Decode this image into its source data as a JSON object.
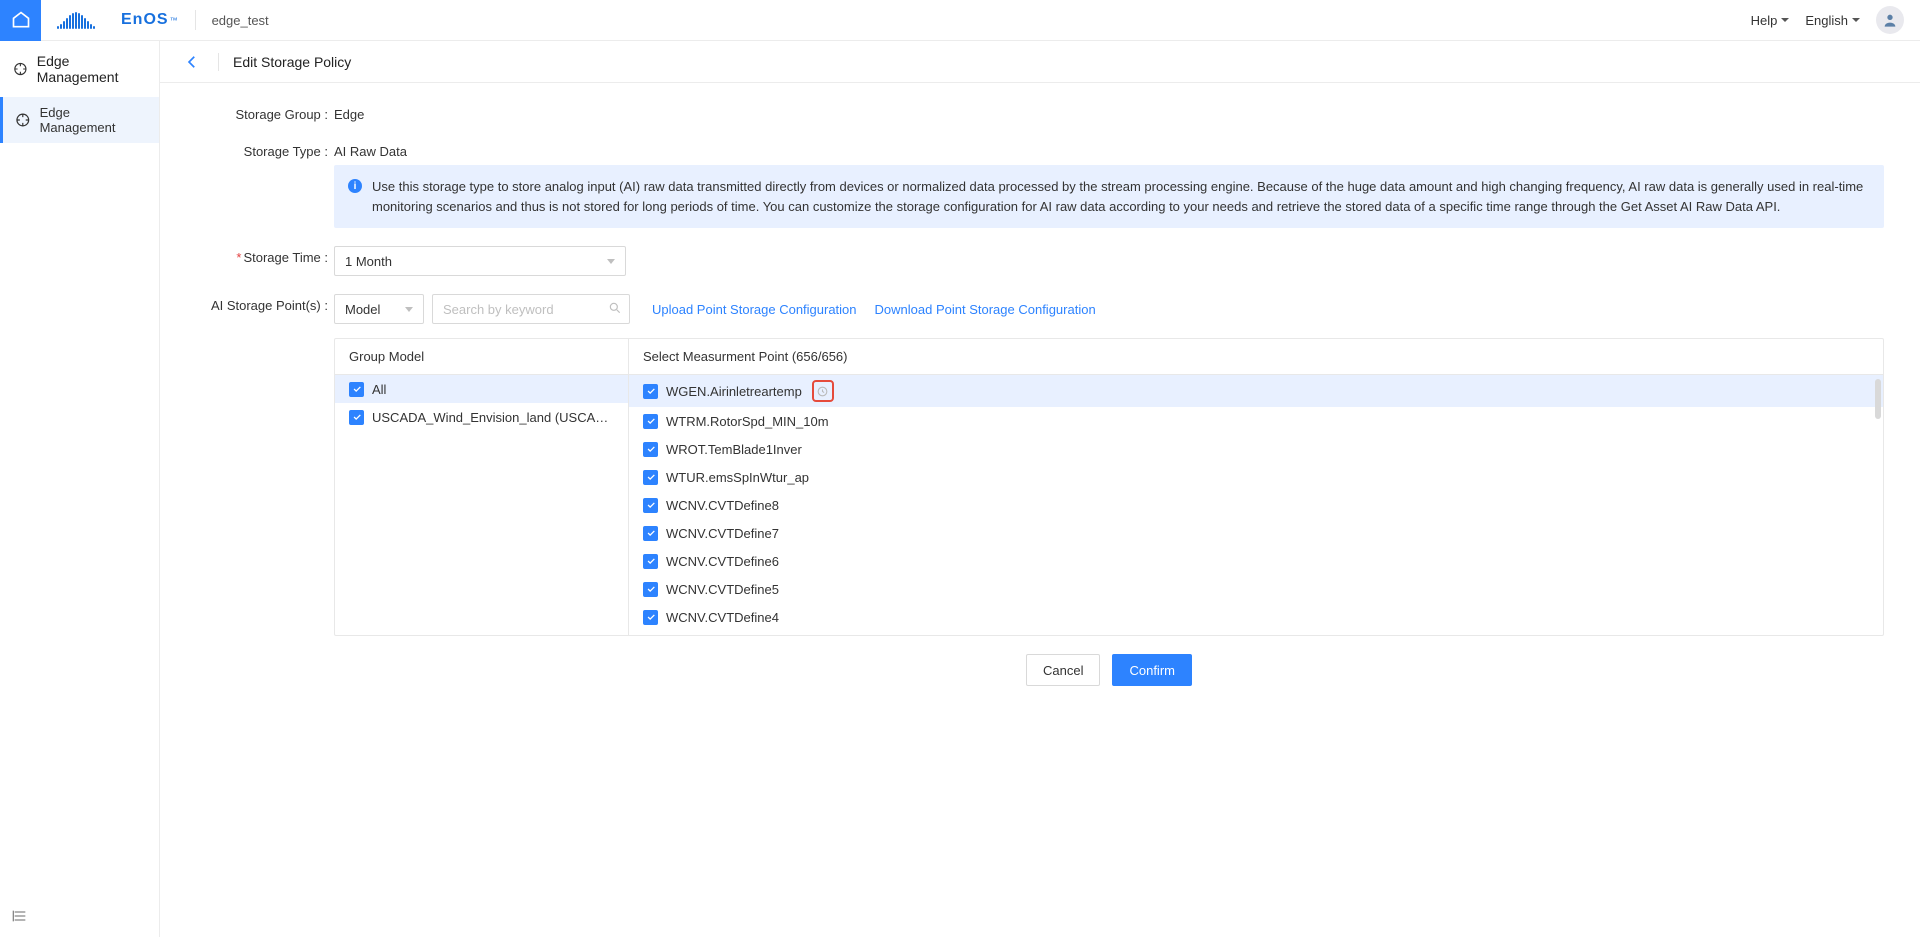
{
  "brand": {
    "name": "EnOS",
    "tm": "™"
  },
  "project": "edge_test",
  "top": {
    "help": "Help",
    "lang": "English"
  },
  "sidebar": {
    "header": "Edge Management",
    "item": "Edge Management"
  },
  "page": {
    "title": "Edit Storage Policy",
    "labels": {
      "storageGroup": "Storage Group :",
      "storageType": "Storage Type :",
      "storageTime": "Storage Time :",
      "storagePoints": "AI Storage Point(s) :"
    },
    "values": {
      "storageGroup": "Edge",
      "storageType": "AI Raw Data",
      "storageTime": "1 Month",
      "modelSel": "Model",
      "searchPlaceholder": "Search by keyword"
    },
    "info": "Use this storage type to store analog input (AI) raw data transmitted directly from devices or normalized data processed by the stream processing engine. Because of the huge data amount and high changing frequency, AI raw data is generally used in real-time monitoring scenarios and thus is not stored for long periods of time. You can customize the storage configuration for AI raw data according to your needs and retrieve the stored data of a specific time range through the Get Asset AI Raw Data API.",
    "links": {
      "upload": "Upload Point Storage Configuration",
      "download": "Download Point Storage Configuration"
    },
    "table": {
      "colA": "Group Model",
      "colB": "Select Measurment Point (656/656)",
      "groups": [
        {
          "label": "All",
          "checked": true
        },
        {
          "label": "USCADA_Wind_Envision_land (USCADA_...",
          "checked": true
        }
      ],
      "points": [
        {
          "label": "WGEN.Airinletreartemp",
          "checked": true,
          "highlight": true,
          "clock": true
        },
        {
          "label": "WTRM.RotorSpd_MIN_10m",
          "checked": true
        },
        {
          "label": "WROT.TemBlade1Inver",
          "checked": true
        },
        {
          "label": "WTUR.emsSpInWtur_ap",
          "checked": true
        },
        {
          "label": "WCNV.CVTDefine8",
          "checked": true
        },
        {
          "label": "WCNV.CVTDefine7",
          "checked": true
        },
        {
          "label": "WCNV.CVTDefine6",
          "checked": true
        },
        {
          "label": "WCNV.CVTDefine5",
          "checked": true
        },
        {
          "label": "WCNV.CVTDefine4",
          "checked": true
        }
      ]
    },
    "buttons": {
      "cancel": "Cancel",
      "confirm": "Confirm"
    }
  }
}
